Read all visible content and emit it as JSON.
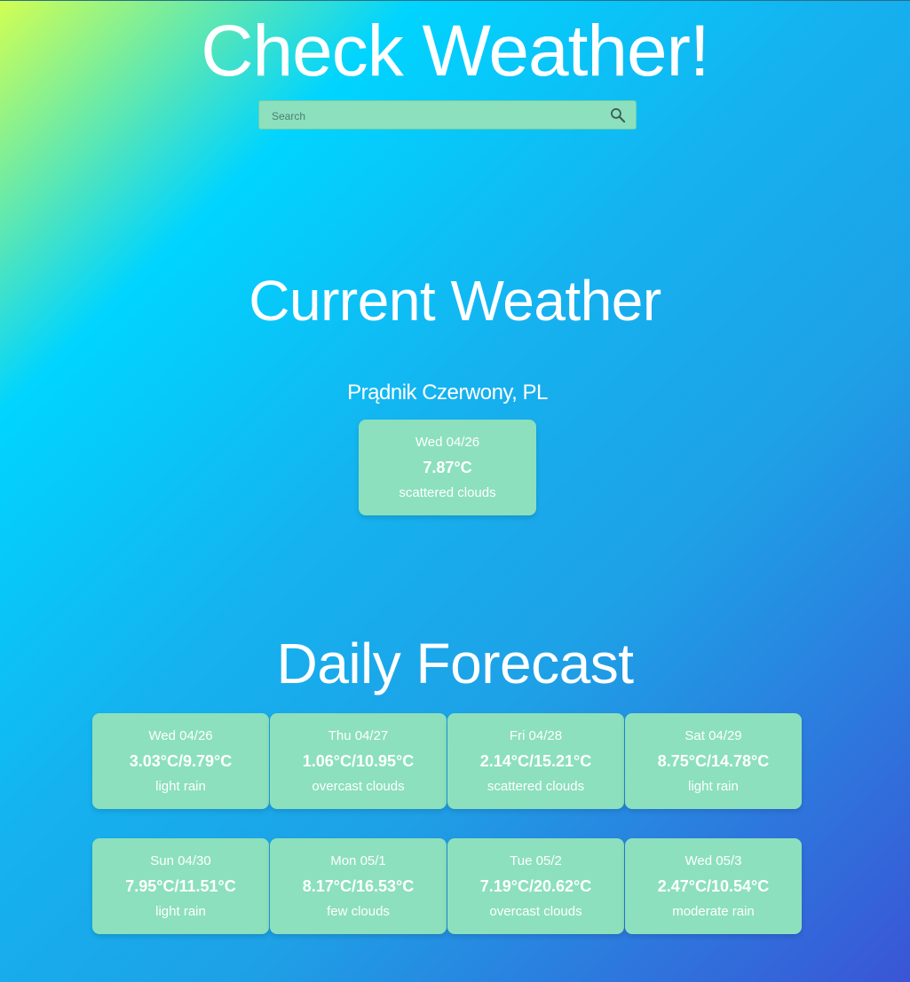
{
  "header": {
    "title": "Check Weather!"
  },
  "search": {
    "placeholder": "Search",
    "value": "",
    "icon": "search-icon"
  },
  "current": {
    "section_title": "Current Weather",
    "location": "Prądnik Czerwony, PL",
    "card": {
      "date": "Wed 04/26",
      "temp": "7.87°C",
      "desc": "scattered clouds"
    }
  },
  "forecast": {
    "section_title": "Daily Forecast",
    "days": [
      {
        "date": "Wed 04/26",
        "temp": "3.03°C/9.79°C",
        "desc": "light rain"
      },
      {
        "date": "Thu 04/27",
        "temp": "1.06°C/10.95°C",
        "desc": "overcast clouds"
      },
      {
        "date": "Fri 04/28",
        "temp": "2.14°C/15.21°C",
        "desc": "scattered clouds"
      },
      {
        "date": "Sat 04/29",
        "temp": "8.75°C/14.78°C",
        "desc": "light rain"
      },
      {
        "date": "Sun 04/30",
        "temp": "7.95°C/11.51°C",
        "desc": "light rain"
      },
      {
        "date": "Mon 05/1",
        "temp": "8.17°C/16.53°C",
        "desc": "few clouds"
      },
      {
        "date": "Tue 05/2",
        "temp": "7.19°C/20.62°C",
        "desc": "overcast clouds"
      },
      {
        "date": "Wed 05/3",
        "temp": "2.47°C/10.54°C",
        "desc": "moderate rain"
      }
    ]
  },
  "colors": {
    "card_bg": "#8ce0bd",
    "text": "#ffffff",
    "gradient_start": "#d2ff52",
    "gradient_mid": "#00d4ff",
    "gradient_end": "#3a55d6"
  }
}
